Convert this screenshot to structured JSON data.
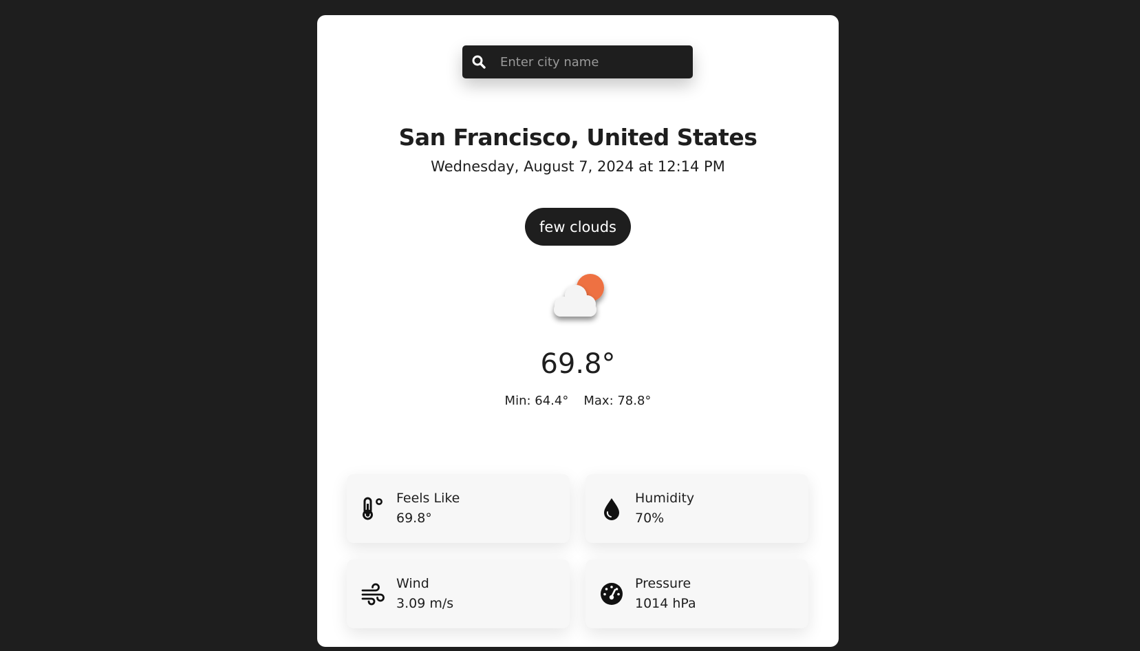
{
  "search": {
    "placeholder": "Enter city name",
    "value": ""
  },
  "location": {
    "city": "San Francisco, United States",
    "datetime": "Wednesday, August 7, 2024 at 12:14 PM"
  },
  "weather": {
    "condition": "few clouds",
    "icon": "partly-cloudy-icon",
    "temperature": "69.8°",
    "min": "Min: 64.4°",
    "max": "Max: 78.8°"
  },
  "details": [
    {
      "icon": "thermometer-icon",
      "label": "Feels Like",
      "value": "69.8°"
    },
    {
      "icon": "droplet-icon",
      "label": "Humidity",
      "value": "70%"
    },
    {
      "icon": "wind-icon",
      "label": "Wind",
      "value": "3.09 m/s"
    },
    {
      "icon": "gauge-icon",
      "label": "Pressure",
      "value": "1014 hPa"
    }
  ],
  "colors": {
    "background": "#1e1e1e",
    "card": "#ffffff",
    "tile": "#f7f7f7",
    "sun": "#ee7143"
  }
}
